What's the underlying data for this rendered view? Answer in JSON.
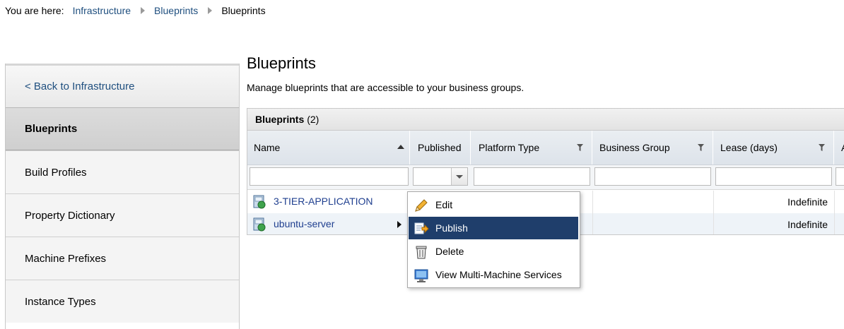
{
  "breadcrumb": {
    "prefix": "You are here:",
    "items": [
      "Infrastructure",
      "Blueprints",
      "Blueprints"
    ]
  },
  "sidebar": {
    "back_label": "< Back to Infrastructure",
    "items": [
      {
        "label": "Blueprints",
        "active": true
      },
      {
        "label": "Build Profiles"
      },
      {
        "label": "Property Dictionary"
      },
      {
        "label": "Machine Prefixes"
      },
      {
        "label": "Instance Types"
      }
    ]
  },
  "main": {
    "title": "Blueprints",
    "description": "Manage blueprints that are accessible to your business groups."
  },
  "grid": {
    "title": "Blueprints",
    "count": "(2)",
    "columns": [
      "Name",
      "Published",
      "Platform Type",
      "Business Group",
      "Lease (days)",
      "A"
    ],
    "rows": [
      {
        "name": "3-TIER-APPLICATION",
        "lease": "Indefinite"
      },
      {
        "name": "ubuntu-server",
        "lease": "Indefinite"
      }
    ]
  },
  "context_menu": {
    "items": [
      {
        "label": "Edit",
        "icon": "pencil-icon"
      },
      {
        "label": "Publish",
        "icon": "publish-icon",
        "highlighted": true
      },
      {
        "label": "Delete",
        "icon": "trash-icon"
      },
      {
        "label": "View Multi-Machine Services",
        "icon": "monitor-icon"
      }
    ]
  },
  "colors": {
    "link": "#1f4f7f",
    "menu_highlight": "#1f3e6b",
    "row_alt": "#eef3f8"
  }
}
